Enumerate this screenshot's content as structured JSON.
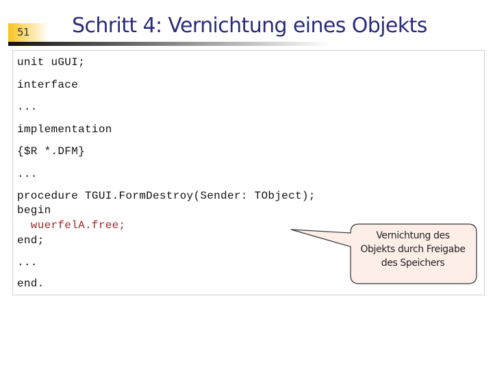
{
  "slide": {
    "number": "51",
    "title": "Schritt 4: Vernichtung eines Objekts"
  },
  "code": {
    "lines": [
      {
        "text": "unit uGUI;",
        "highlight": false
      },
      {
        "text": "interface",
        "highlight": false
      },
      {
        "text": "...",
        "highlight": false
      },
      {
        "text": "implementation",
        "highlight": false
      },
      {
        "text": "{$R *.DFM}",
        "highlight": false
      },
      {
        "text": "...",
        "highlight": false
      },
      {
        "text": "procedure TGUI.FormDestroy(Sender: TObject);",
        "highlight": false
      },
      {
        "text": "begin",
        "highlight": false
      },
      {
        "text": "  wuerfelA.free;",
        "highlight": true
      },
      {
        "text": "end;",
        "highlight": false
      },
      {
        "text": "...",
        "highlight": false
      },
      {
        "text": "end.",
        "highlight": false
      }
    ]
  },
  "callout": {
    "lines": [
      "Vernichtung des",
      "Objekts durch Freigabe",
      "des Speichers"
    ],
    "fill_color": "#fdeee8",
    "border_color": "#333333"
  },
  "colors": {
    "title": "#2b2b7a",
    "highlight_code": "#a0282a",
    "accent_number_box": "#f7c21e"
  }
}
